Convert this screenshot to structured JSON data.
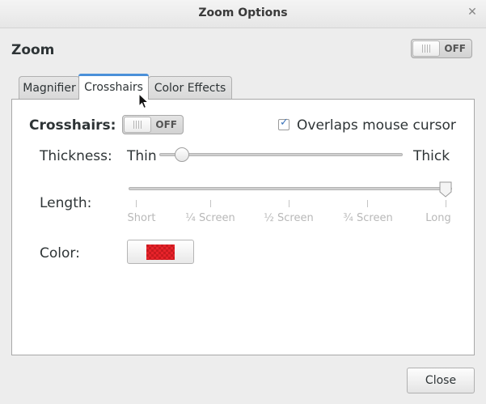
{
  "window": {
    "title": "Zoom Options",
    "close_glyph": "✕"
  },
  "zoom": {
    "label": "Zoom",
    "state": "OFF"
  },
  "tabs": [
    {
      "label": "Magnifier",
      "selected": false
    },
    {
      "label": "Crosshairs",
      "selected": true
    },
    {
      "label": "Color Effects",
      "selected": false
    }
  ],
  "crosshairs": {
    "label": "Crosshairs:",
    "state": "OFF",
    "overlaps_label": "Overlaps mouse cursor",
    "overlaps_checked": true,
    "thickness": {
      "label": "Thickness:",
      "min_label": "Thin",
      "max_label": "Thick",
      "value_fraction": 0.09
    },
    "length": {
      "label": "Length:",
      "marks": [
        "Short",
        "¼ Screen",
        "½ Screen",
        "¾ Screen",
        "Long"
      ],
      "value_fraction": 1.0
    },
    "color": {
      "label": "Color:",
      "swatch": "#e8232a"
    }
  },
  "footer": {
    "close_label": "Close"
  },
  "icons": {
    "cursor": "mouse-pointer-icon"
  }
}
